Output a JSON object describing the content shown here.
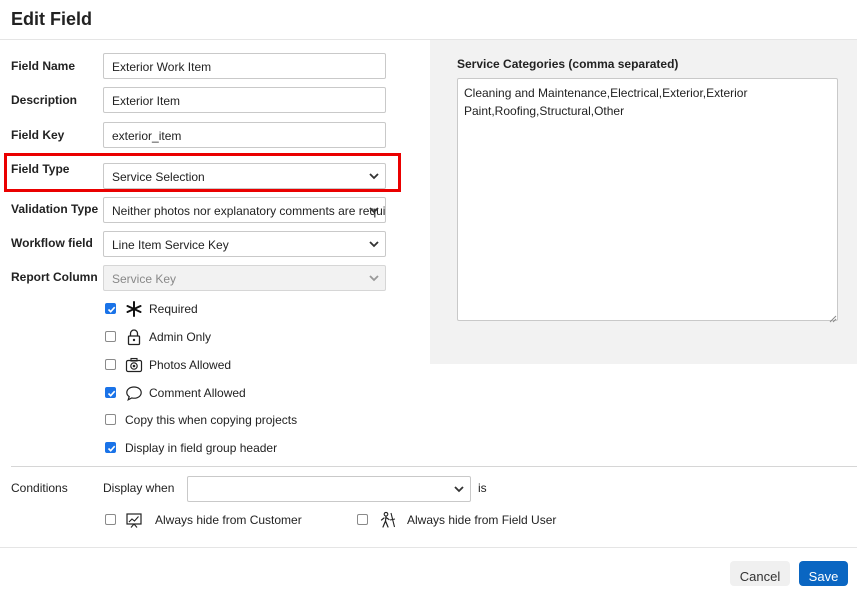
{
  "dialog": {
    "title": "Edit Field"
  },
  "form": {
    "field_name": {
      "label": "Field Name",
      "value": "Exterior Work Item"
    },
    "description": {
      "label": "Description",
      "value": "Exterior Item"
    },
    "field_key": {
      "label": "Field Key",
      "value": "exterior_item"
    },
    "field_type": {
      "label": "Field Type",
      "value": "Service Selection"
    },
    "validation_type": {
      "label": "Validation Type",
      "value": "Neither photos nor explanatory comments are required"
    },
    "workflow_field": {
      "label": "Workflow field",
      "value": "Line Item Service Key"
    },
    "report_column": {
      "label": "Report Column",
      "value": "Service Key"
    }
  },
  "options": [
    {
      "label": "Required",
      "checked": true,
      "icon": "asterisk-icon"
    },
    {
      "label": "Admin Only",
      "checked": false,
      "icon": "lock-icon"
    },
    {
      "label": "Photos Allowed",
      "checked": false,
      "icon": "camera-icon"
    },
    {
      "label": "Comment Allowed",
      "checked": true,
      "icon": "comment-icon"
    },
    {
      "label": "Copy this when copying projects",
      "checked": false
    },
    {
      "label": "Display in field group header",
      "checked": true
    }
  ],
  "service_categories": {
    "label": "Service Categories (comma separated)",
    "value": "Cleaning and Maintenance,Electrical,Exterior,Exterior Paint,Roofing,Structural,Other"
  },
  "conditions": {
    "label": "Conditions",
    "display_when": "Display when",
    "select_value": "",
    "suffix": "is",
    "hide_customer": {
      "label": "Always hide from Customer",
      "checked": false,
      "icon": "presentation-icon"
    },
    "hide_field_user": {
      "label": "Always hide from Field User",
      "checked": false,
      "icon": "field-worker-icon"
    }
  },
  "footer": {
    "cancel": "Cancel",
    "save": "Save"
  },
  "colors": {
    "highlight": "#ea0000",
    "primary": "#0a66c2",
    "checkbox": "#1a73e8"
  }
}
